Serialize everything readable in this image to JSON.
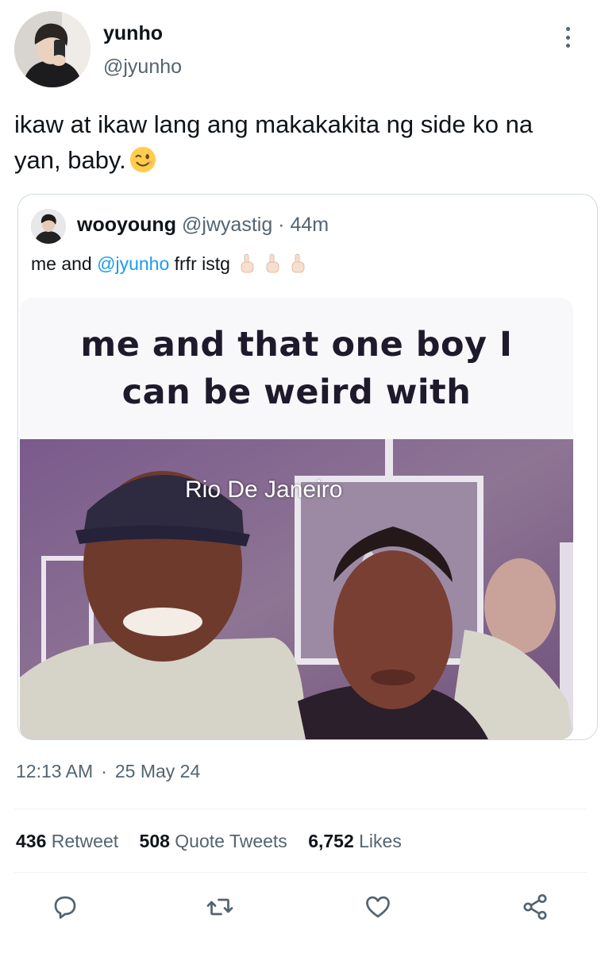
{
  "author": {
    "name": "yunho",
    "handle": "@jyunho",
    "avatar_icon": "profile-photo"
  },
  "tweet": {
    "text": "ikaw at ikaw lang ang makakakita ng side ko na yan, baby.",
    "emoji": "winking-face-emoji"
  },
  "quoted_tweet": {
    "author_name": "wooyoung",
    "author_handle": "@jwyastig",
    "time_sep": " · ",
    "time": "44m",
    "text_before": "me and ",
    "mention": "@jyunho",
    "text_after": " frfr istg",
    "emojis": [
      "index-pointing-up-emoji",
      "index-pointing-up-emoji",
      "index-pointing-up-emoji"
    ],
    "media": {
      "caption_line1": "me and that one boy I",
      "caption_line2": "can be weird with",
      "overlay_text": "Rio De Janeiro"
    }
  },
  "meta": {
    "time": "12:13 AM",
    "dot": "·",
    "date": "25 May 24"
  },
  "stats": {
    "retweets_count": "436",
    "retweets_label": "Retweet",
    "quotes_count": "508",
    "quotes_label": "Quote Tweets",
    "likes_count": "6,752",
    "likes_label": "Likes"
  },
  "actions": [
    "reply-icon",
    "retweet-icon",
    "like-icon",
    "share-icon"
  ],
  "colors": {
    "text": "#0f1419",
    "secondary": "#536471",
    "link": "#1d9bf0",
    "border": "#cfd9de"
  }
}
